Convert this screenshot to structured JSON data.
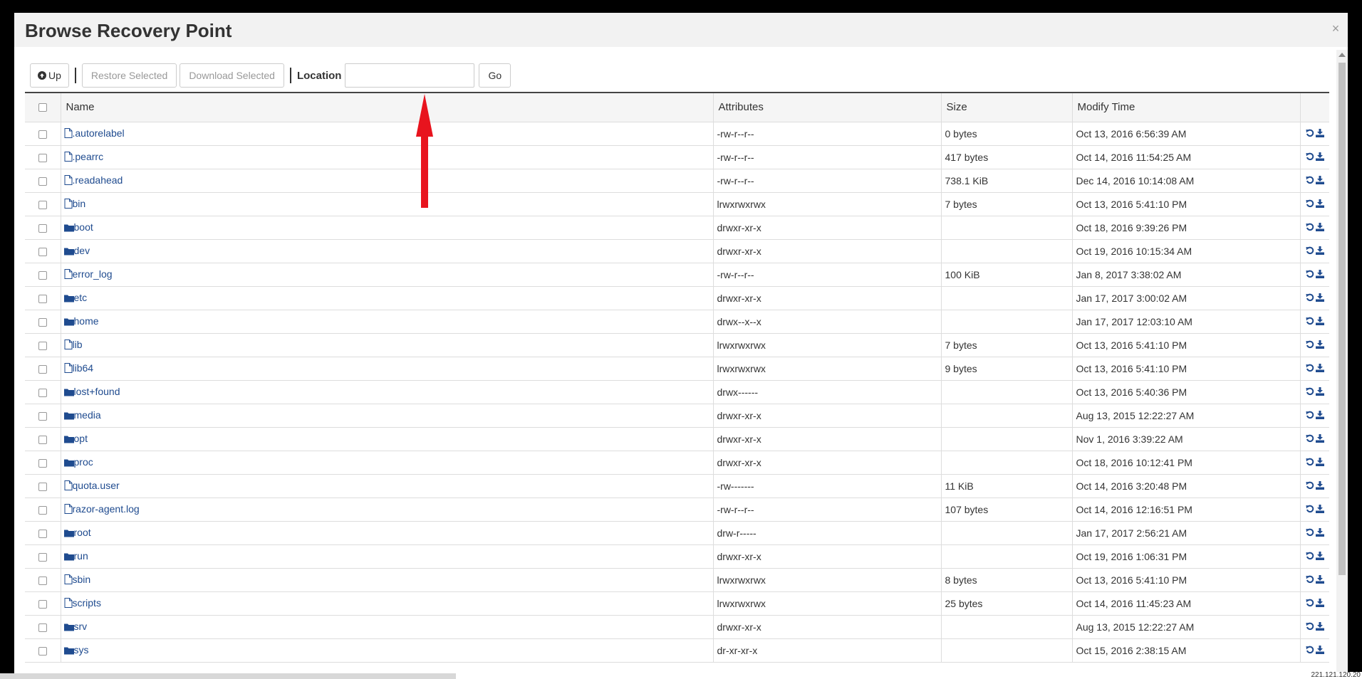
{
  "modal": {
    "title": "Browse Recovery Point",
    "close_glyph": "×"
  },
  "toolbar": {
    "up_label": "Up",
    "restore_label": "Restore Selected",
    "download_label": "Download Selected",
    "location_label": "Location",
    "location_value": "",
    "go_label": "Go"
  },
  "table": {
    "headers": [
      "Name",
      "Attributes",
      "Size",
      "Modify Time"
    ],
    "rows": [
      {
        "type": "file",
        "name": ".autorelabel",
        "attributes": "-rw-r--r--",
        "size": "0 bytes",
        "modified": "Oct 13, 2016 6:56:39 AM"
      },
      {
        "type": "file",
        "name": ".pearrc",
        "attributes": "-rw-r--r--",
        "size": "417 bytes",
        "modified": "Oct 14, 2016 11:54:25 AM"
      },
      {
        "type": "file",
        "name": ".readahead",
        "attributes": "-rw-r--r--",
        "size": "738.1 KiB",
        "modified": "Dec 14, 2016 10:14:08 AM"
      },
      {
        "type": "file",
        "name": "bin",
        "attributes": "lrwxrwxrwx",
        "size": "7 bytes",
        "modified": "Oct 13, 2016 5:41:10 PM"
      },
      {
        "type": "folder",
        "name": "boot",
        "attributes": "drwxr-xr-x",
        "size": "",
        "modified": "Oct 18, 2016 9:39:26 PM"
      },
      {
        "type": "folder",
        "name": "dev",
        "attributes": "drwxr-xr-x",
        "size": "",
        "modified": "Oct 19, 2016 10:15:34 AM"
      },
      {
        "type": "file",
        "name": "error_log",
        "attributes": "-rw-r--r--",
        "size": "100 KiB",
        "modified": "Jan 8, 2017 3:38:02 AM"
      },
      {
        "type": "folder",
        "name": "etc",
        "attributes": "drwxr-xr-x",
        "size": "",
        "modified": "Jan 17, 2017 3:00:02 AM"
      },
      {
        "type": "folder",
        "name": "home",
        "attributes": "drwx--x--x",
        "size": "",
        "modified": "Jan 17, 2017 12:03:10 AM"
      },
      {
        "type": "file",
        "name": "lib",
        "attributes": "lrwxrwxrwx",
        "size": "7 bytes",
        "modified": "Oct 13, 2016 5:41:10 PM"
      },
      {
        "type": "file",
        "name": "lib64",
        "attributes": "lrwxrwxrwx",
        "size": "9 bytes",
        "modified": "Oct 13, 2016 5:41:10 PM"
      },
      {
        "type": "folder",
        "name": "lost+found",
        "attributes": "drwx------",
        "size": "",
        "modified": "Oct 13, 2016 5:40:36 PM"
      },
      {
        "type": "folder",
        "name": "media",
        "attributes": "drwxr-xr-x",
        "size": "",
        "modified": "Aug 13, 2015 12:22:27 AM"
      },
      {
        "type": "folder",
        "name": "opt",
        "attributes": "drwxr-xr-x",
        "size": "",
        "modified": "Nov 1, 2016 3:39:22 AM"
      },
      {
        "type": "folder",
        "name": "proc",
        "attributes": "drwxr-xr-x",
        "size": "",
        "modified": "Oct 18, 2016 10:12:41 PM"
      },
      {
        "type": "file",
        "name": "quota.user",
        "attributes": "-rw-------",
        "size": "11 KiB",
        "modified": "Oct 14, 2016 3:20:48 PM"
      },
      {
        "type": "file",
        "name": "razor-agent.log",
        "attributes": "-rw-r--r--",
        "size": "107 bytes",
        "modified": "Oct 14, 2016 12:16:51 PM"
      },
      {
        "type": "folder",
        "name": "root",
        "attributes": "drw-r-----",
        "size": "",
        "modified": "Jan 17, 2017 2:56:21 AM"
      },
      {
        "type": "folder",
        "name": "run",
        "attributes": "drwxr-xr-x",
        "size": "",
        "modified": "Oct 19, 2016 1:06:31 PM"
      },
      {
        "type": "file",
        "name": "sbin",
        "attributes": "lrwxrwxrwx",
        "size": "8 bytes",
        "modified": "Oct 13, 2016 5:41:10 PM"
      },
      {
        "type": "file",
        "name": "scripts",
        "attributes": "lrwxrwxrwx",
        "size": "25 bytes",
        "modified": "Oct 14, 2016 11:45:23 AM"
      },
      {
        "type": "folder",
        "name": "srv",
        "attributes": "drwxr-xr-x",
        "size": "",
        "modified": "Aug 13, 2015 12:22:27 AM"
      },
      {
        "type": "folder",
        "name": "sys",
        "attributes": "dr-xr-xr-x",
        "size": "",
        "modified": "Oct 15, 2016 2:38:15 AM"
      }
    ]
  },
  "status": {
    "ip_text": "221.121.120.20"
  },
  "colors": {
    "link": "#1f4b8f",
    "icon": "#1f4b8f",
    "annotation_arrow": "#e8141e"
  },
  "icons": {
    "up": "circle-arrow-up-icon",
    "file": "file-icon",
    "folder": "folder-icon",
    "restore": "restore-icon",
    "download": "download-icon",
    "close": "close-icon"
  }
}
